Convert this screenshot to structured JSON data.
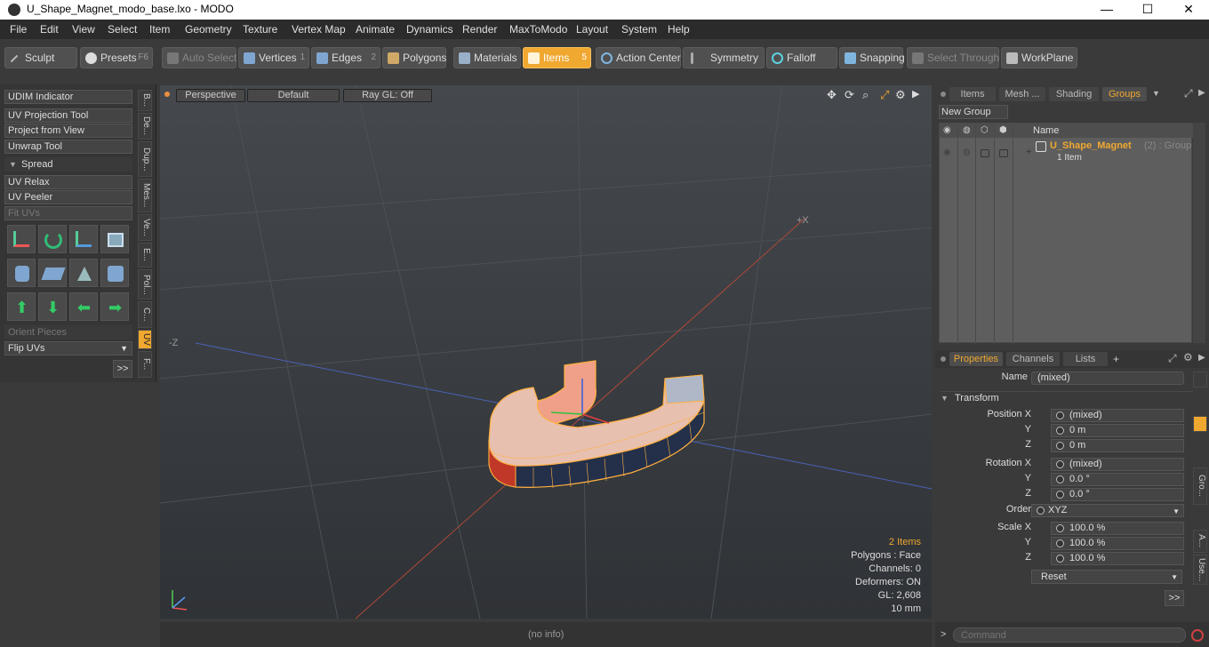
{
  "window": {
    "title": "U_Shape_Magnet_modo_base.lxo - MODO",
    "min": "—",
    "max": "☐",
    "close": "✕"
  },
  "menu": [
    "File",
    "Edit",
    "View",
    "Select",
    "Item",
    "Geometry",
    "Texture",
    "Vertex Map",
    "Animate",
    "Dynamics",
    "Render",
    "MaxToModo",
    "Layout",
    "System",
    "Help"
  ],
  "toolbar": {
    "sculpt": "Sculpt",
    "presets": "Presets",
    "presets_key": "F6",
    "auto_select": "Auto Select",
    "vertices": "Vertices",
    "vertices_n": "1",
    "edges": "Edges",
    "edges_n": "2",
    "polygons": "Polygons",
    "materials": "Materials",
    "items": "Items",
    "items_n": "5",
    "action_center": "Action Center",
    "symmetry": "Symmetry",
    "falloff": "Falloff",
    "snapping": "Snapping",
    "select_through": "Select Through",
    "workplane": "WorkPlane"
  },
  "left": {
    "udim": "UDIM Indicator",
    "uv_projection": "UV Projection Tool",
    "project_view": "Project from View",
    "unwrap": "Unwrap Tool",
    "spread": "Spread",
    "uv_relax": "UV Relax",
    "uv_peeler": "UV Peeler",
    "fit_uvs": "Fit UVs",
    "orient": "Orient Pieces",
    "flip": "Flip UVs",
    "more": ">>",
    "vtabs": [
      "B...",
      "De...",
      "Dup...",
      "Mes...",
      "Ve...",
      "E...",
      "Pol...",
      "C...",
      "UV",
      "F..."
    ]
  },
  "viewport": {
    "perspective": "Perspective",
    "default": "Default",
    "raygl": "Ray GL: Off",
    "items_count": "2 Items",
    "polygons": "Polygons : Face",
    "channels": "Channels: 0",
    "deformers": "Deformers: ON",
    "gl": "GL: 2,608",
    "scale": "10 mm",
    "axis_z": "-Z",
    "axis_x": "+X",
    "status": "(no info)"
  },
  "groups": {
    "tabs": [
      "Items",
      "Mesh ...",
      "Shading",
      "Groups"
    ],
    "new_group": "New Group",
    "col_name": "Name",
    "group_name": "U_Shape_Magnet",
    "group_meta": "(2) : Group",
    "sub": "1 Item"
  },
  "props": {
    "tabs": [
      "Properties",
      "Channels",
      "Lists",
      "+"
    ],
    "name_label": "Name",
    "name_value": "(mixed)",
    "transform": "Transform",
    "pos_x_label": "Position X",
    "pos_x": "(mixed)",
    "pos_y_label": "Y",
    "pos_y": "0 m",
    "pos_z_label": "Z",
    "pos_z": "0 m",
    "rot_x_label": "Rotation X",
    "rot_x": "(mixed)",
    "rot_y_label": "Y",
    "rot_y": "0.0 °",
    "rot_z_label": "Z",
    "rot_z": "0.0 °",
    "order_label": "Order",
    "order": "XYZ",
    "scl_x_label": "Scale X",
    "scl_x": "100.0 %",
    "scl_y_label": "Y",
    "scl_y": "100.0 %",
    "scl_z_label": "Z",
    "scl_z": "100.0 %",
    "reset": "Reset",
    "more": ">>",
    "vtabs": [
      "Gro...",
      "A...",
      "Use..."
    ]
  },
  "command": {
    "prompt": ">",
    "placeholder": "Command"
  }
}
